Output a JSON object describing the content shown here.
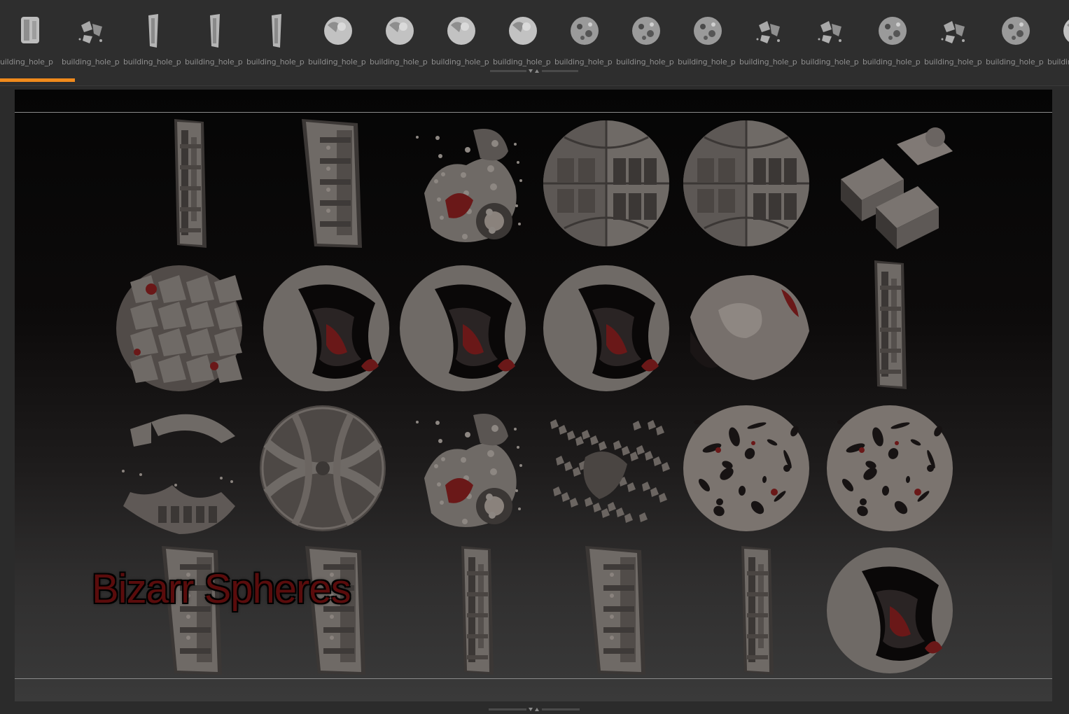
{
  "thumbnail_bar": {
    "thumbnails": [
      {
        "label": "uilding_hole_p",
        "icon": "box-mesh-thumbnail-icon"
      },
      {
        "label": "building_hole_p",
        "icon": "debris-mesh-thumbnail-icon"
      },
      {
        "label": "building_hole_p",
        "icon": "panel-mesh-thumbnail-icon"
      },
      {
        "label": "building_hole_p",
        "icon": "panel-mesh-thumbnail-icon"
      },
      {
        "label": "building_hole_p",
        "icon": "panel-mesh-thumbnail-icon"
      },
      {
        "label": "building_hole_p",
        "icon": "sphere-mesh-thumbnail-icon"
      },
      {
        "label": "building_hole_p",
        "icon": "sphere-mesh-thumbnail-icon"
      },
      {
        "label": "building_hole_p",
        "icon": "sphere-mesh-thumbnail-icon"
      },
      {
        "label": "building_hole_p",
        "icon": "sphere-mesh-thumbnail-icon"
      },
      {
        "label": "building_hole_p",
        "icon": "textured-sphere-thumbnail-icon"
      },
      {
        "label": "building_hole_p",
        "icon": "textured-sphere-thumbnail-icon"
      },
      {
        "label": "building_hole_p",
        "icon": "textured-sphere-thumbnail-icon"
      },
      {
        "label": "building_hole_p",
        "icon": "debris-mesh-thumbnail-icon"
      },
      {
        "label": "building_hole_p",
        "icon": "debris-mesh-thumbnail-icon"
      },
      {
        "label": "building_hole_p",
        "icon": "textured-sphere-thumbnail-icon"
      },
      {
        "label": "building_hole_p",
        "icon": "debris-mesh-thumbnail-icon"
      },
      {
        "label": "building_hole_p",
        "icon": "textured-sphere-thumbnail-icon"
      },
      {
        "label": "building",
        "icon": "sphere-mesh-thumbnail-icon"
      }
    ]
  },
  "viewport": {
    "title": "Bizarr Spheres"
  },
  "colors": {
    "accent": "#f08a1c",
    "mesh_fill": "#6f6a66",
    "mesh_dark": "#3b3735",
    "mesh_red": "#6a1818",
    "title_red": "#5a0c0c"
  }
}
